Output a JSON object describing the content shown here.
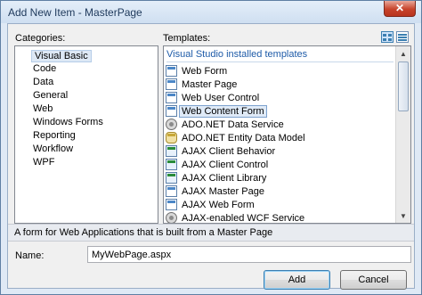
{
  "window": {
    "title": "Add New Item - MasterPage",
    "close_glyph": "✕"
  },
  "categories": {
    "label": "Categories:",
    "root": "Visual Basic",
    "items": [
      "Code",
      "Data",
      "General",
      "Web",
      "Windows Forms",
      "Reporting",
      "Workflow",
      "WPF"
    ]
  },
  "templates": {
    "label": "Templates:",
    "group_header": "Visual Studio installed templates",
    "selected_index": 3,
    "items": [
      {
        "label": "Web Form",
        "icon": "web-form-icon"
      },
      {
        "label": "Master Page",
        "icon": "master-page-icon"
      },
      {
        "label": "Web User Control",
        "icon": "web-user-control-icon"
      },
      {
        "label": "Web Content Form",
        "icon": "web-content-form-icon"
      },
      {
        "label": "ADO.NET Data Service",
        "icon": "data-service-icon"
      },
      {
        "label": "ADO.NET Entity Data Model",
        "icon": "entity-model-icon"
      },
      {
        "label": "AJAX Client Behavior",
        "icon": "ajax-behavior-icon"
      },
      {
        "label": "AJAX Client Control",
        "icon": "ajax-control-icon"
      },
      {
        "label": "AJAX Client Library",
        "icon": "ajax-library-icon"
      },
      {
        "label": "AJAX Master Page",
        "icon": "ajax-master-page-icon"
      },
      {
        "label": "AJAX Web Form",
        "icon": "ajax-web-form-icon"
      },
      {
        "label": "AJAX-enabled WCF Service",
        "icon": "wcf-service-icon"
      }
    ]
  },
  "description": "A form for Web Applications that is built from a Master Page",
  "name_field": {
    "label": "Name:",
    "value": "MyWebPage.aspx"
  },
  "buttons": {
    "add": "Add",
    "cancel": "Cancel"
  }
}
